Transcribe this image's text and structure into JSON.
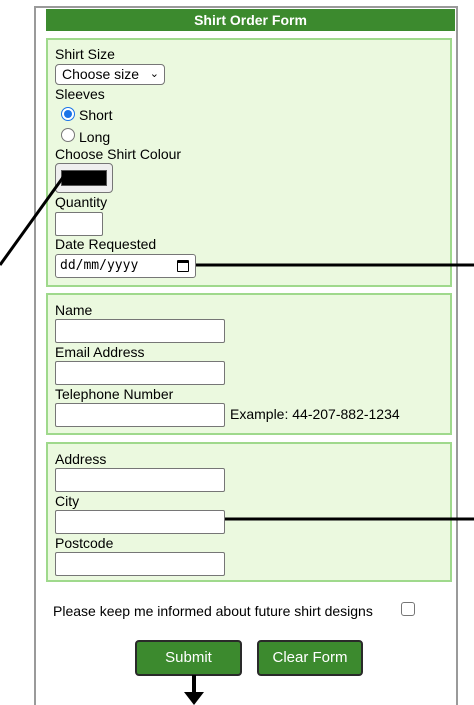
{
  "form": {
    "title": "Shirt Order Form",
    "shirt_size": {
      "label": "Shirt Size",
      "selected": "Choose size"
    },
    "sleeves": {
      "label": "Sleeves",
      "options": [
        {
          "label": "Short",
          "checked": true
        },
        {
          "label": "Long",
          "checked": false
        }
      ]
    },
    "colour": {
      "label": "Choose Shirt Colour",
      "value": "#000000"
    },
    "quantity": {
      "label": "Quantity",
      "value": ""
    },
    "date": {
      "label": "Date Requested",
      "placeholder": "dd/mm/yyyy"
    },
    "contact": {
      "name_label": "Name",
      "email_label": "Email Address",
      "phone_label": "Telephone Number",
      "phone_example": "Example: 44-207-882-1234"
    },
    "address": {
      "address_label": "Address",
      "city_label": "City",
      "postcode_label": "Postcode"
    },
    "newsletter": {
      "label": "Please keep me informed about future shirt designs",
      "checked": false
    },
    "buttons": {
      "submit": "Submit",
      "clear": "Clear Form"
    }
  },
  "colors": {
    "header_green": "#3c8a2e",
    "panel_bg": "#ebf9df",
    "panel_border": "#9fd98c",
    "radio_accent": "#1a73e8"
  }
}
